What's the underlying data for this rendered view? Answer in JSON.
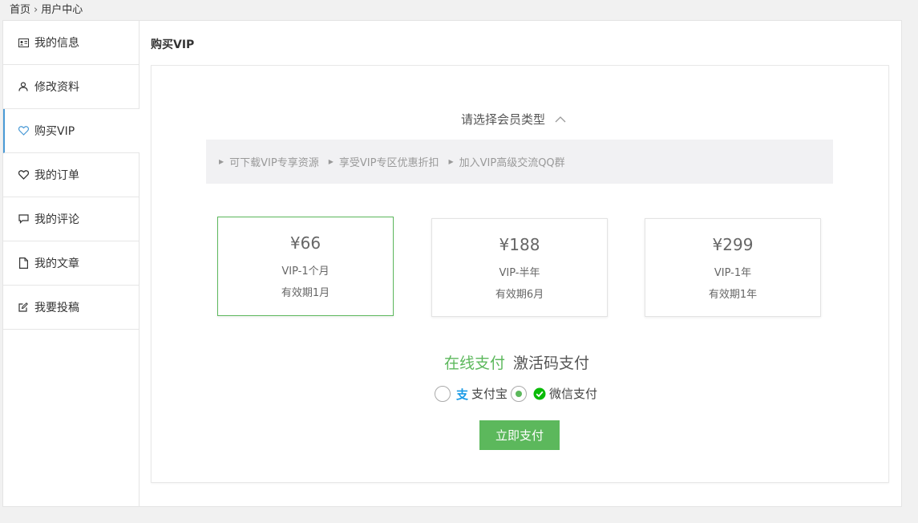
{
  "breadcrumb": {
    "home": "首页",
    "separator": "›",
    "current": "用户中心"
  },
  "sidebar": {
    "items": [
      {
        "label": "我的信息",
        "icon": "id-card-icon"
      },
      {
        "label": "修改资料",
        "icon": "user-icon"
      },
      {
        "label": "购买VIP",
        "icon": "heart-icon",
        "active": true
      },
      {
        "label": "我的订单",
        "icon": "heart-icon"
      },
      {
        "label": "我的评论",
        "icon": "comment-icon"
      },
      {
        "label": "我的文章",
        "icon": "document-icon"
      },
      {
        "label": "我要投稿",
        "icon": "edit-icon"
      }
    ]
  },
  "main": {
    "title": "购买VIP",
    "choose_label": "请选择会员类型",
    "perks": [
      "可下载VIP专享资源",
      "享受VIP专区优惠折扣",
      "加入VIP高级交流QQ群"
    ],
    "plans": [
      {
        "price": "¥66",
        "name": "VIP-1个月",
        "validity": "有效期1月",
        "selected": true
      },
      {
        "price": "¥188",
        "name": "VIP-半年",
        "validity": "有效期6月",
        "selected": false
      },
      {
        "price": "¥299",
        "name": "VIP-1年",
        "validity": "有效期1年",
        "selected": false
      }
    ],
    "pay_tabs": [
      {
        "label": "在线支付",
        "active": true
      },
      {
        "label": "激活码支付",
        "active": false
      }
    ],
    "methods": [
      {
        "label": "支付宝",
        "icon": "alipay-icon",
        "checked": false
      },
      {
        "label": "微信支付",
        "icon": "wechat-pay-icon",
        "checked": true
      }
    ],
    "pay_button": "立即支付"
  },
  "colors": {
    "accent": "#5cb85c",
    "active_border": "#4a9ad6",
    "alipay": "#1a9be6",
    "wechat": "#09bb07"
  }
}
